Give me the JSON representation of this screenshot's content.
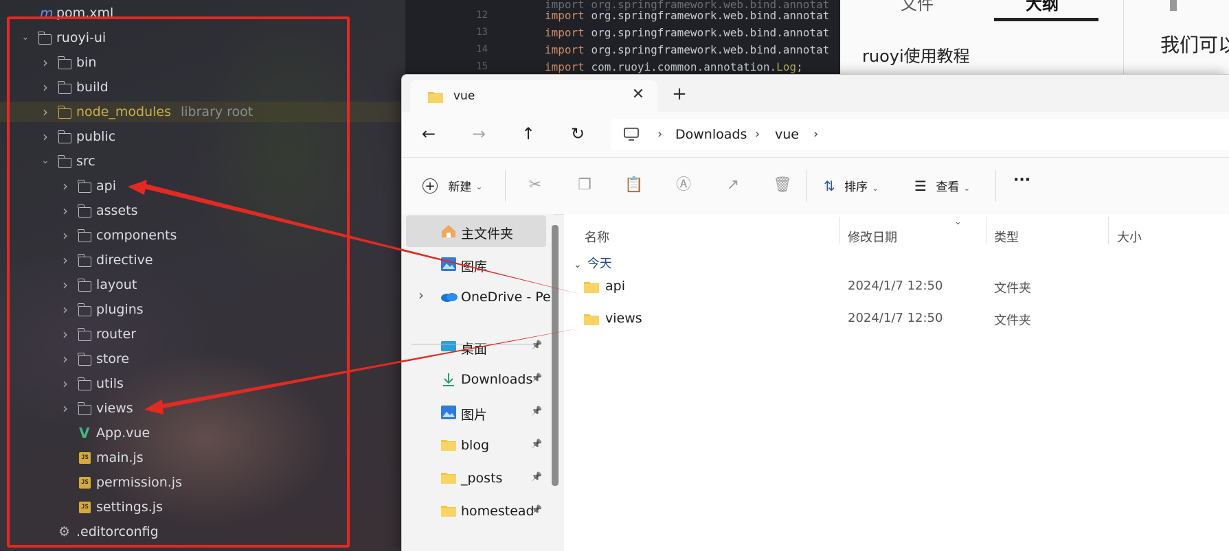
{
  "ide": {
    "tree": [
      {
        "label": "pom.xml",
        "type": "maven"
      },
      {
        "label": "ruoyi-ui",
        "type": "folder",
        "expanded": true
      },
      {
        "label": "bin",
        "type": "folder"
      },
      {
        "label": "build",
        "type": "folder"
      },
      {
        "label": "node_modules",
        "type": "folder",
        "hint": "library root"
      },
      {
        "label": "public",
        "type": "folder"
      },
      {
        "label": "src",
        "type": "folder",
        "expanded": true
      },
      {
        "label": "api",
        "type": "folder"
      },
      {
        "label": "assets",
        "type": "folder"
      },
      {
        "label": "components",
        "type": "folder"
      },
      {
        "label": "directive",
        "type": "folder"
      },
      {
        "label": "layout",
        "type": "folder"
      },
      {
        "label": "plugins",
        "type": "folder"
      },
      {
        "label": "router",
        "type": "folder"
      },
      {
        "label": "store",
        "type": "folder"
      },
      {
        "label": "utils",
        "type": "folder"
      },
      {
        "label": "views",
        "type": "folder"
      },
      {
        "label": "App.vue",
        "type": "vue"
      },
      {
        "label": "main.js",
        "type": "js"
      },
      {
        "label": "permission.js",
        "type": "js"
      },
      {
        "label": "settings.js",
        "type": "js"
      },
      {
        "label": ".editorconfig",
        "type": "gear"
      }
    ]
  },
  "code": {
    "lines": [
      {
        "no": "12",
        "kw": "import",
        "text": "org.springframework.web.bind.annotat"
      },
      {
        "no": "13",
        "kw": "import",
        "text": "org.springframework.web.bind.annotat"
      },
      {
        "no": "14",
        "kw": "import",
        "text": "org.springframework.web.bind.annotat"
      },
      {
        "no": "15",
        "kw": "import",
        "text": "com.ruoyi.common.annotation.",
        "tail": "Log",
        "end": ";"
      }
    ]
  },
  "notes": {
    "tab1": "文件",
    "tab2": "大纲",
    "item": "ruoyi使用教程",
    "right_text": "我们可以"
  },
  "explorer": {
    "tab_title": "vue",
    "tab_close": "✕",
    "tab_new": "+",
    "nav": {
      "back": "←",
      "forward": "→",
      "up": "↑",
      "refresh": "↻"
    },
    "breadcrumb": [
      "Downloads",
      "vue"
    ],
    "toolbar": {
      "new_label": "新建",
      "sort_label": "排序",
      "view_label": "查看",
      "more": "···"
    },
    "sidebar": {
      "items": [
        {
          "label": "主文件夹",
          "icon": "home-icon",
          "selected": true
        },
        {
          "label": "图库",
          "icon": "gallery-icon"
        },
        {
          "label": "OneDrive - Per",
          "icon": "onedrive-icon",
          "expandable": true
        },
        {
          "label": "桌面",
          "icon": "desktop-icon",
          "pinned": true
        },
        {
          "label": "Downloads",
          "icon": "download-icon",
          "pinned": true
        },
        {
          "label": "图片",
          "icon": "pictures-icon",
          "pinned": true
        },
        {
          "label": "blog",
          "icon": "folder-icon",
          "pinned": true
        },
        {
          "label": "_posts",
          "icon": "folder-icon",
          "pinned": true
        },
        {
          "label": "homestead",
          "icon": "folder-icon",
          "pinned": true
        }
      ]
    },
    "columns": {
      "name": "名称",
      "modified": "修改日期",
      "type": "类型",
      "size": "大小"
    },
    "group_label": "今天",
    "files": [
      {
        "name": "api",
        "modified": "2024/1/7 12:50",
        "type": "文件夹"
      },
      {
        "name": "views",
        "modified": "2024/1/7 12:50",
        "type": "文件夹"
      }
    ]
  },
  "colors": {
    "annotation_red": "#e22a22",
    "folder_yellow": "#f4c542",
    "node_modules_yellow": "#c9b045"
  }
}
